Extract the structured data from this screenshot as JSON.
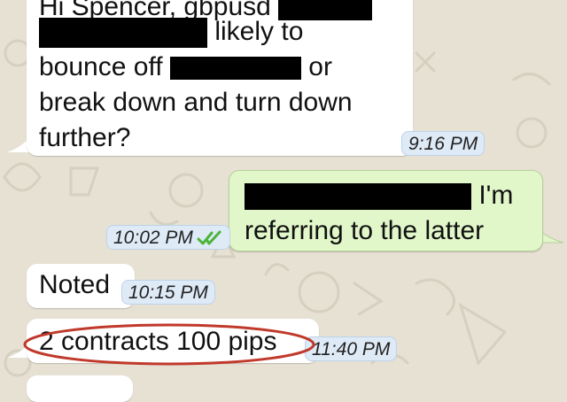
{
  "chat": {
    "messages": [
      {
        "direction": "incoming",
        "lines": [
          "Hi Spencer, gbpusd",
          "likely to",
          "bounce off",
          "or",
          "break down and turn down",
          "further?"
        ],
        "time": "9:16 PM"
      },
      {
        "direction": "outgoing",
        "lines": [
          "I'm",
          "referring to the latter"
        ],
        "time": "10:02 PM",
        "status": "read"
      },
      {
        "direction": "incoming",
        "text": "Noted",
        "time": "10:15 PM"
      },
      {
        "direction": "incoming",
        "text": "2 contracts 100 pips",
        "time": "11:40 PM",
        "annotation": "circled"
      }
    ]
  },
  "colors": {
    "background": "#e6e1d3",
    "incoming_bubble": "#ffffff",
    "outgoing_bubble": "#e1f7c9",
    "timestamp_badge": "#dfeaf7",
    "read_check": "#4cb43a",
    "annotation_circle": "#c0392b"
  },
  "icons": {
    "read_status": "double-check-icon"
  }
}
